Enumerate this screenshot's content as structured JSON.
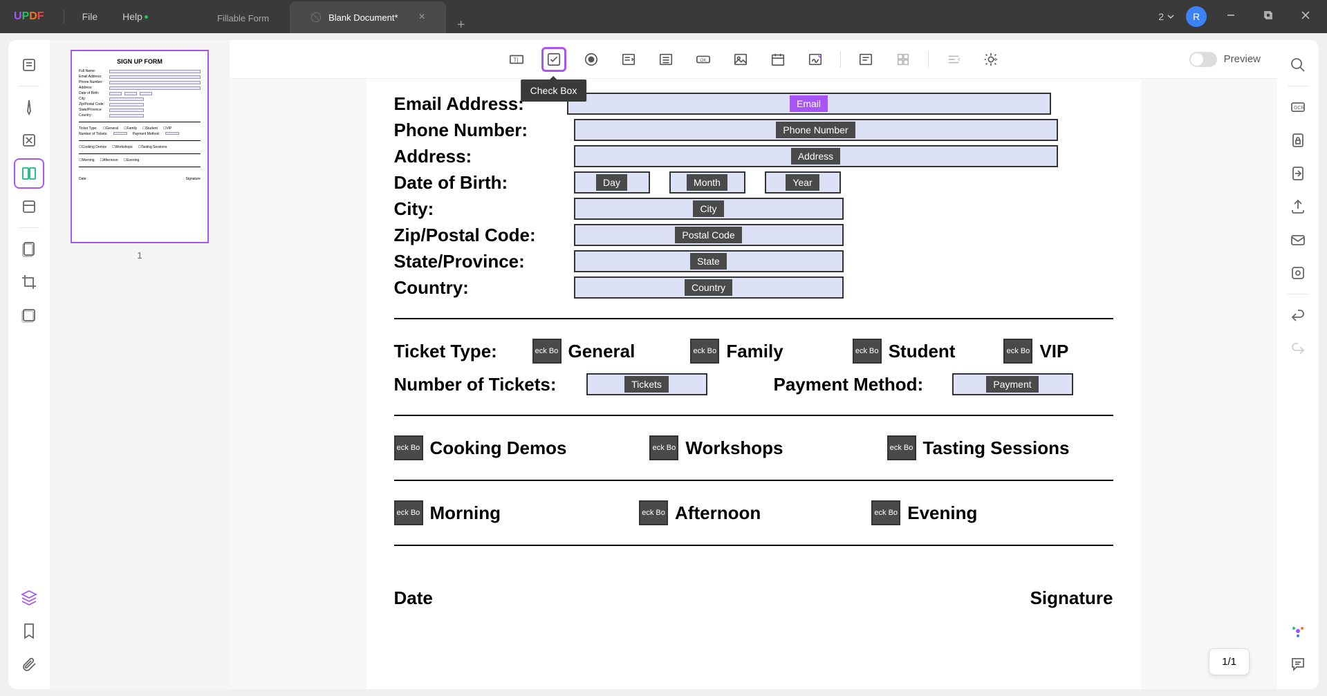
{
  "titlebar": {
    "logo": "UPDF",
    "menu": {
      "file": "File",
      "help": "Help"
    },
    "tabs": [
      {
        "label": "Fillable Form",
        "active": false
      },
      {
        "label": "Blank Document*",
        "active": true
      }
    ],
    "tab_count": "2",
    "avatar_initial": "R"
  },
  "form_toolbar": {
    "tooltip": "Check Box",
    "preview_label": "Preview"
  },
  "thumbnail": {
    "title": "SIGN UP FORM",
    "page_num": "1"
  },
  "form": {
    "labels": {
      "email": "Email Address:",
      "phone": "Phone Number:",
      "address": "Address:",
      "dob": "Date of Birth:",
      "city": "City:",
      "zip": "Zip/Postal Code:",
      "state": "State/Province:",
      "country": "Country:",
      "ticket_type": "Ticket Type:",
      "num_tickets": "Number of Tickets:",
      "payment": "Payment Method:",
      "date": "Date",
      "signature": "Signature"
    },
    "field_tags": {
      "email": "Email",
      "phone": "Phone Number",
      "address": "Address",
      "day": "Day",
      "month": "Month",
      "year": "Year",
      "city": "City",
      "postal": "Postal Code",
      "state": "State",
      "country": "Country",
      "tickets": "Tickets",
      "payment": "Payment",
      "checkbox": "eck Bo"
    },
    "options": {
      "ticket_types": [
        "General",
        "Family",
        "Student",
        "VIP"
      ],
      "activities": [
        "Cooking Demos",
        "Workshops",
        "Tasting Sessions"
      ],
      "times": [
        "Morning",
        "Afternoon",
        "Evening"
      ]
    }
  },
  "page_indicator": "1/1"
}
